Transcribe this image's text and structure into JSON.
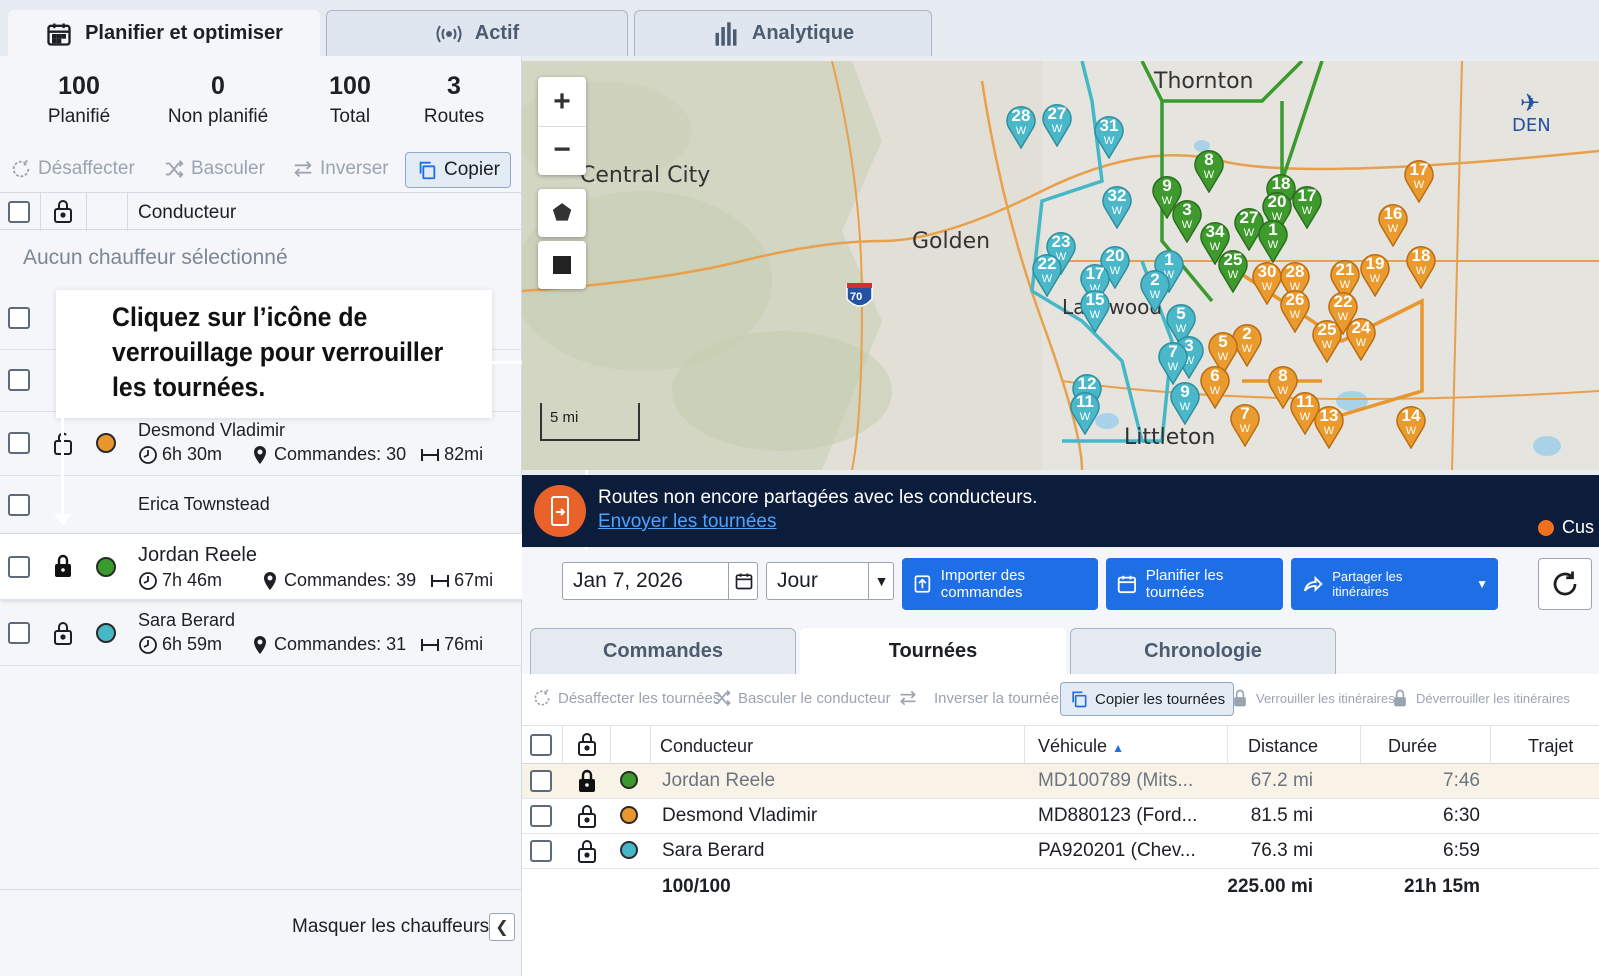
{
  "top_tabs": [
    {
      "label": "Planifier et optimiser",
      "icon": "calendar-icon"
    },
    {
      "label": "Actif",
      "icon": "broadcast-icon"
    },
    {
      "label": "Analytique",
      "icon": "bar-chart-icon"
    }
  ],
  "stats": [
    {
      "value": "100",
      "label": "Planifié"
    },
    {
      "value": "0",
      "label": "Non planifié"
    },
    {
      "value": "100",
      "label": "Total"
    },
    {
      "value": "3",
      "label": "Routes"
    }
  ],
  "left_toolbar": {
    "unassign": "Désaffecter",
    "switch": "Basculer",
    "reverse": "Inverser",
    "copy": "Copier"
  },
  "left_table": {
    "driver_header": "Conducteur",
    "no_driver": "Aucun chauffeur sélectionné"
  },
  "callout": "Cliquez sur l’icône de verrouillage pour verrouiller les tournées.",
  "drivers": [
    {
      "name": "Desmond Vladimir",
      "time": "6h 30m",
      "orders": "Commandes: 30",
      "distance": "82mi",
      "color": "#e8962e",
      "locked": false
    },
    {
      "name": "Erica Townstead"
    },
    {
      "name": "Jordan Reele",
      "time": "7h 46m",
      "orders": "Commandes: 39",
      "distance": "67mi",
      "color": "#3a9a2e",
      "locked": true
    },
    {
      "name": "Sara Berard",
      "time": "6h 59m",
      "orders": "Commandes: 31",
      "distance": "76mi",
      "color": "#45b8c8",
      "locked": false
    }
  ],
  "hide_drivers": "Masquer les chauffeurs",
  "map": {
    "labels": [
      "Central City",
      "Golden",
      "Thornton",
      "Littleton",
      "Lakewood",
      "DEN"
    ],
    "highway": "70",
    "scale": "5 mi",
    "zoom_in": "+",
    "zoom_out": "−",
    "pin_letter": "W",
    "teal_pins": [
      "28",
      "27",
      "31",
      "32",
      "23",
      "22",
      "20",
      "17",
      "15",
      "1",
      "2",
      "5",
      "3",
      "7",
      "9",
      "12",
      "11"
    ],
    "green_pins": [
      "8",
      "9",
      "18",
      "17",
      "20",
      "3",
      "27",
      "34",
      "25",
      "1"
    ],
    "orange_pins": [
      "17",
      "16",
      "18",
      "19",
      "21",
      "30",
      "28",
      "26",
      "22",
      "25",
      "24",
      "2",
      "5",
      "6",
      "8",
      "11",
      "13",
      "14",
      "7"
    ]
  },
  "banner": {
    "message": "Routes non encore partagées avec les conducteurs.",
    "link": "Envoyer les tournées",
    "right": "Cus"
  },
  "controls": {
    "date": "Jan 7, 2026",
    "period": "Jour",
    "import": "Importer des commandes",
    "plan": "Planifier les tournées",
    "share": "Partager les itinéraires"
  },
  "bottom_tabs": [
    "Commandes",
    "Tournées",
    "Chronologie"
  ],
  "routes_toolbar": {
    "unassign": "Désaffecter les tournées",
    "switch": "Basculer le conducteur",
    "reverse": "Inverser la tournée",
    "copy": "Copier les tournées",
    "lock": "Verrouiller les itinéraires",
    "unlock": "Déverrouiller les itinéraires"
  },
  "routes_table": {
    "headers": {
      "driver": "Conducteur",
      "vehicle": "Véhicule",
      "distance": "Distance",
      "duration": "Durée",
      "trip": "Trajet"
    },
    "rows": [
      {
        "driver": "Jordan Reele",
        "vehicle": "MD100789 (Mits...",
        "distance": "67.2 mi",
        "duration": "7:46",
        "color": "#3a9a2e",
        "locked": true
      },
      {
        "driver": "Desmond Vladimir",
        "vehicle": "MD880123 (Ford...",
        "distance": "81.5 mi",
        "duration": "6:30",
        "color": "#e8962e",
        "locked": false
      },
      {
        "driver": "Sara Berard",
        "vehicle": "PA920201 (Chev...",
        "distance": "76.3 mi",
        "duration": "6:59",
        "color": "#45b8c8",
        "locked": false
      }
    ],
    "totals": {
      "count": "100/100",
      "distance": "225.00 mi",
      "duration": "21h 15m"
    }
  }
}
